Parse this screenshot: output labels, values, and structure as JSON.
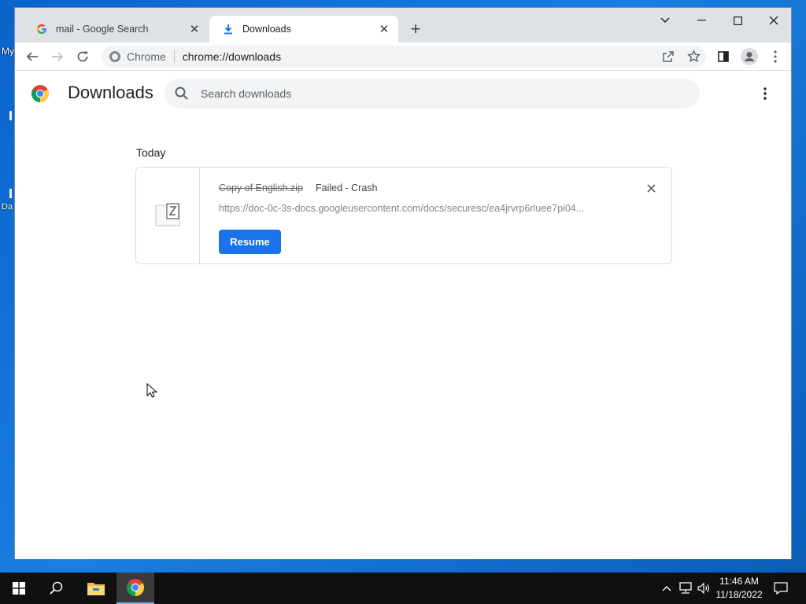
{
  "desktop": {
    "icon_labels": [
      "My",
      "Da"
    ]
  },
  "browser": {
    "tabs": [
      {
        "title": "mail - Google Search",
        "favicon": "google-g-icon",
        "active": false
      },
      {
        "title": "Downloads",
        "favicon": "download-icon",
        "active": true
      }
    ],
    "omnibox": {
      "chip": "Chrome",
      "url": "chrome://downloads"
    }
  },
  "downloads": {
    "title": "Downloads",
    "search_placeholder": "Search downloads",
    "date_group": "Today",
    "items": [
      {
        "filename": "Copy of English.zip",
        "status": "Failed - Crash",
        "url": "https://doc-0c-3s-docs.googleusercontent.com/docs/securesc/ea4jrvrp6rluee7pi04...",
        "action": "Resume"
      }
    ]
  },
  "taskbar": {
    "time": "11:46 AM",
    "date": "11/18/2022"
  },
  "colors": {
    "accent": "#1a73e8",
    "desktop": "#0a63c9",
    "taskbar": "#101010"
  }
}
